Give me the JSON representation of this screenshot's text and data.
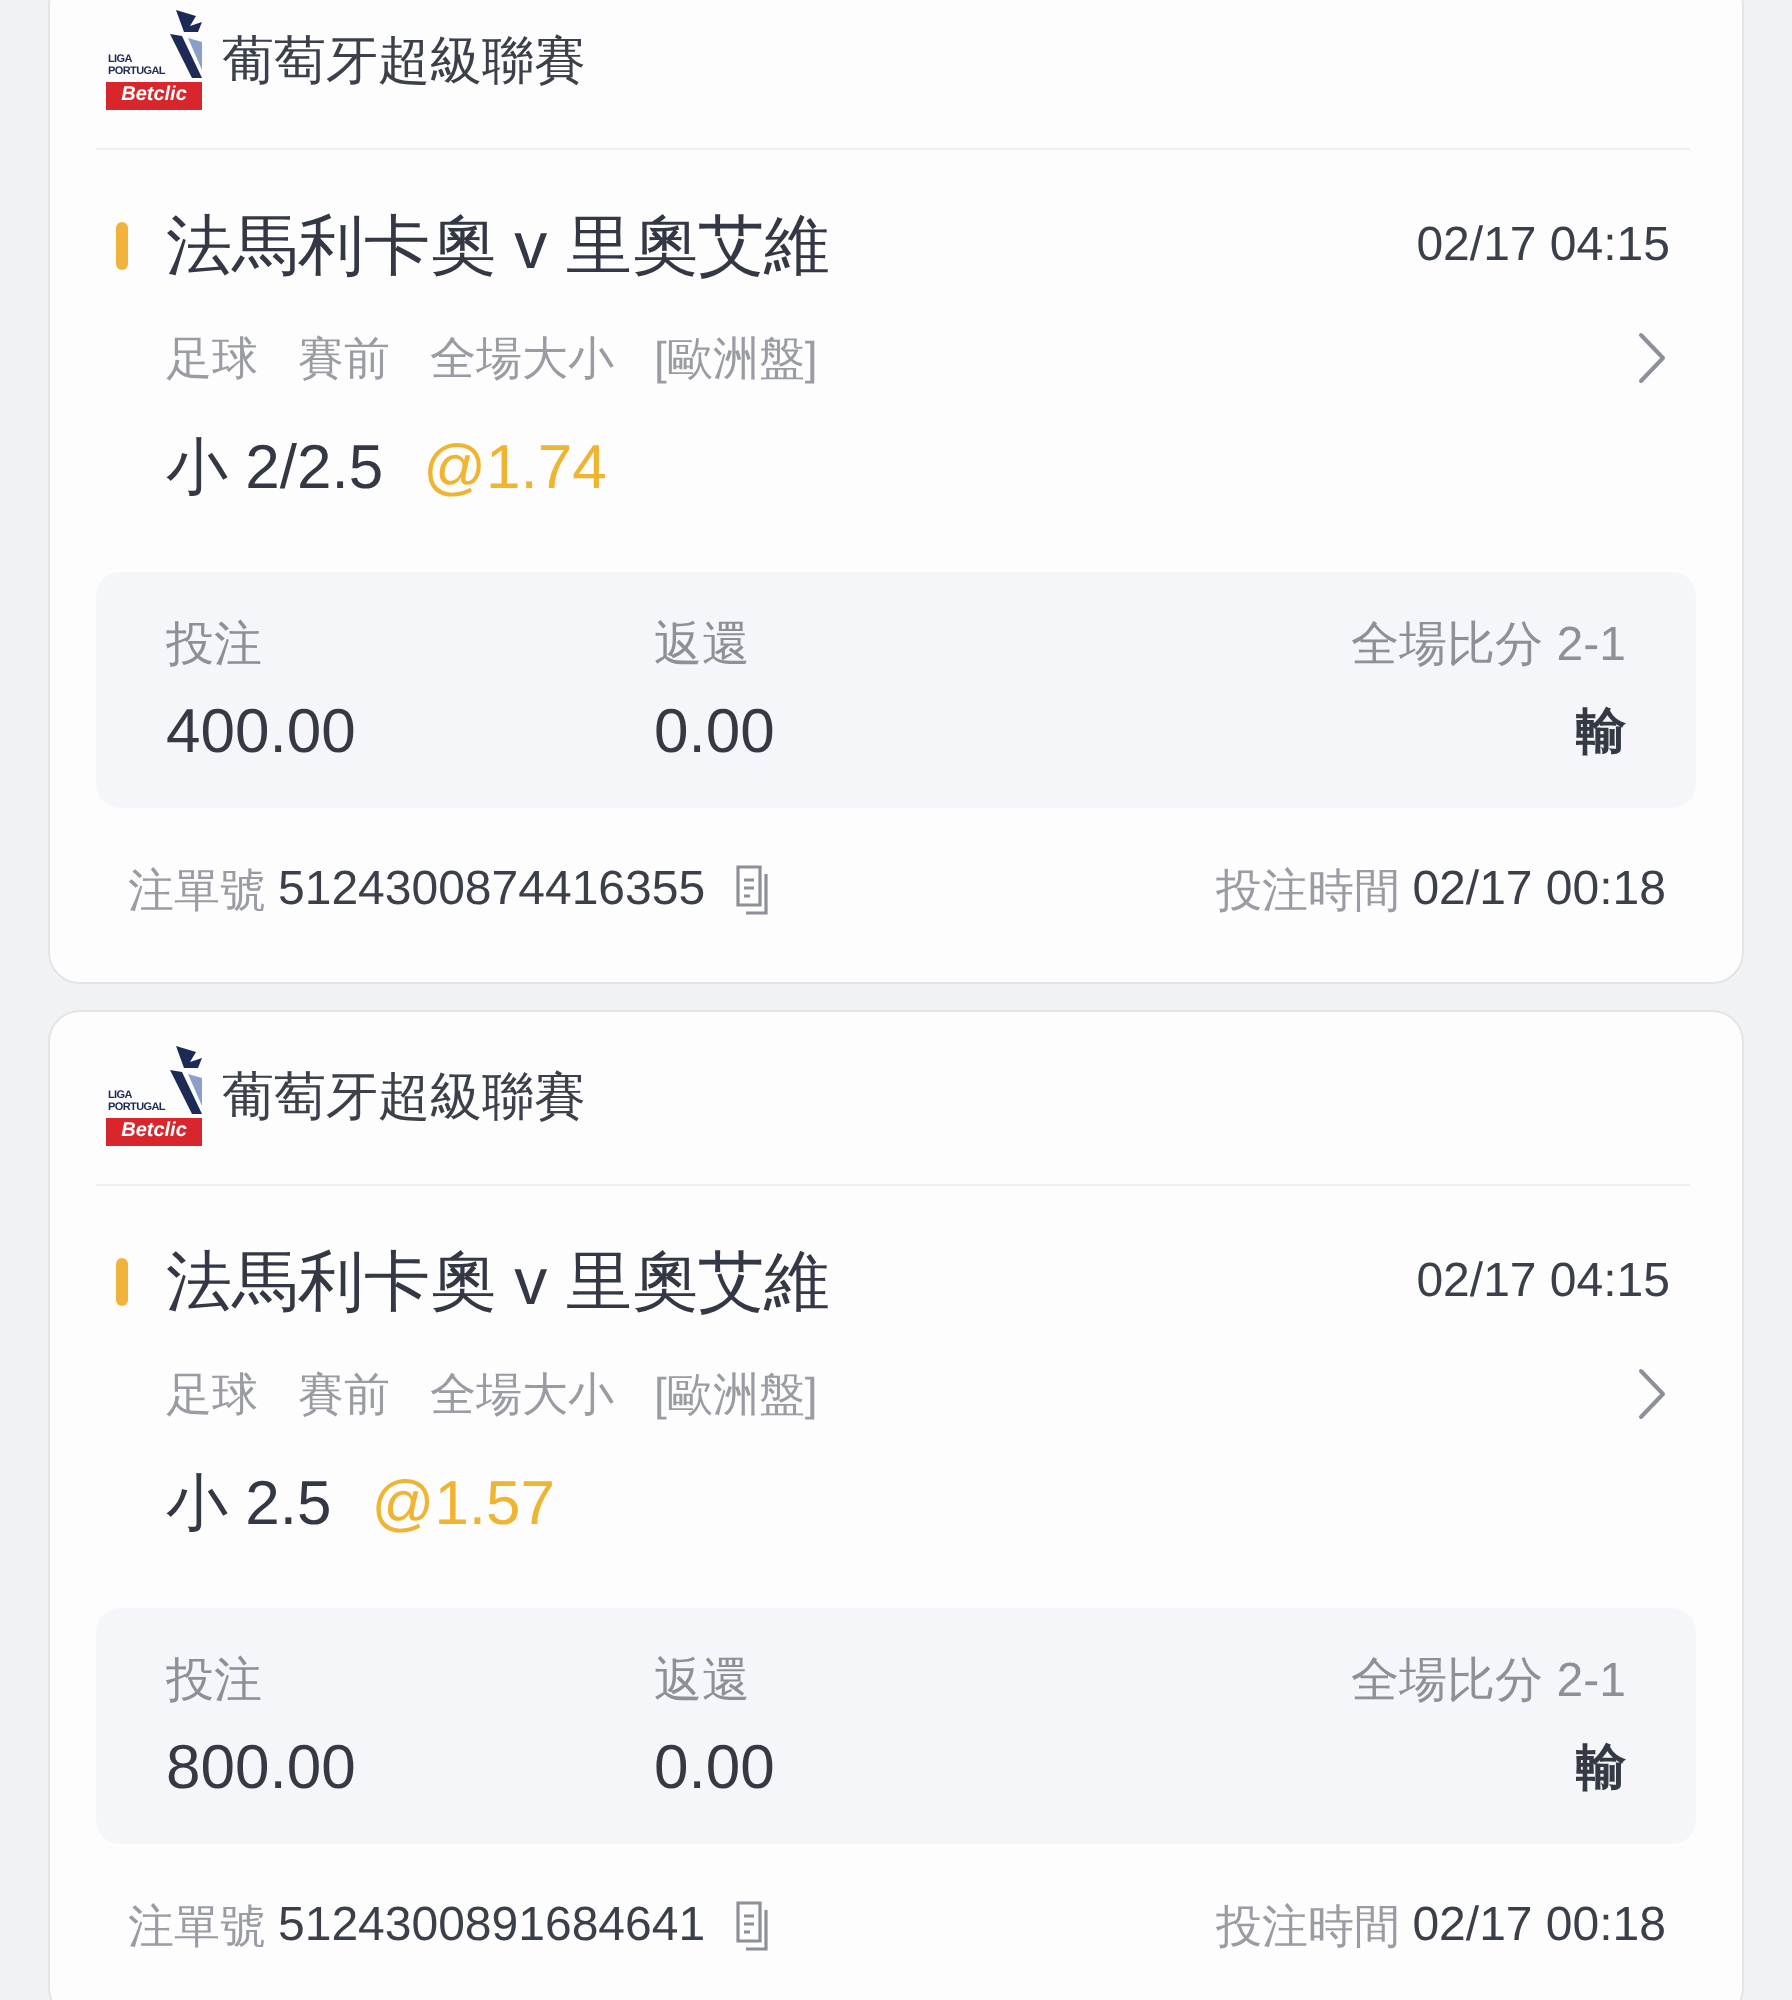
{
  "bets": [
    {
      "league": {
        "logo_lines": [
          "LIGA",
          "PORTUGAL"
        ],
        "sponsor": "Betclic",
        "name": "葡萄牙超級聯賽"
      },
      "match": {
        "title": "法馬利卡奧 v 里奧艾維",
        "kickoff": "02/17 04:15"
      },
      "tags": [
        "足球",
        "賽前",
        "全場大小",
        "[歐洲盤]"
      ],
      "pick": {
        "selection": "小 2/2.5",
        "odds": "@1.74"
      },
      "stake": {
        "label": "投注",
        "value": "400.00"
      },
      "payout": {
        "label": "返還",
        "value": "0.00"
      },
      "score": "全場比分 2-1",
      "outcome": "輸",
      "footer": {
        "order_label": "注單號",
        "order_no": "5124300874416355",
        "time_label": "投注時間",
        "time": "02/17 00:18"
      }
    },
    {
      "league": {
        "logo_lines": [
          "LIGA",
          "PORTUGAL"
        ],
        "sponsor": "Betclic",
        "name": "葡萄牙超級聯賽"
      },
      "match": {
        "title": "法馬利卡奧 v 里奧艾維",
        "kickoff": "02/17 04:15"
      },
      "tags": [
        "足球",
        "賽前",
        "全場大小",
        "[歐洲盤]"
      ],
      "pick": {
        "selection": "小 2.5",
        "odds": "@1.57"
      },
      "stake": {
        "label": "投注",
        "value": "800.00"
      },
      "payout": {
        "label": "返還",
        "value": "0.00"
      },
      "score": "全場比分 2-1",
      "outcome": "輸",
      "footer": {
        "order_label": "注單號",
        "order_no": "5124300891684641",
        "time_label": "投注時間",
        "time": "02/17 00:18"
      }
    }
  ]
}
